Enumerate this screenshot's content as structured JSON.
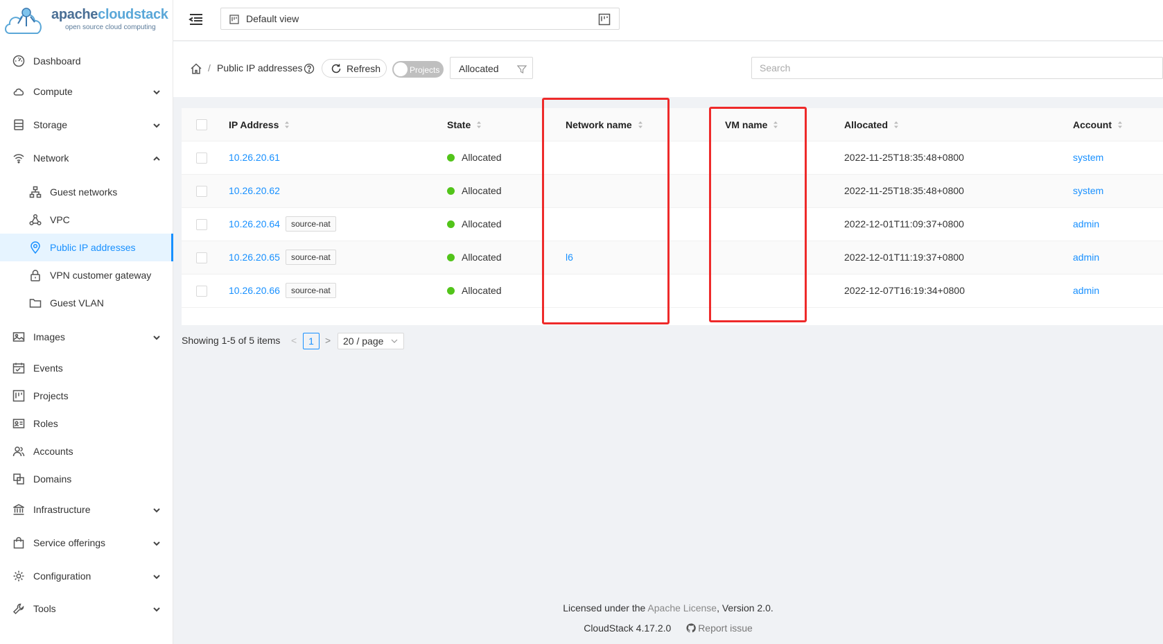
{
  "brand": {
    "name_part1": "apache",
    "name_part2": "cloudstack",
    "tagline": "open source cloud computing"
  },
  "sidebar": {
    "items": [
      {
        "label": "Dashboard",
        "icon": "dashboard-icon"
      },
      {
        "label": "Compute",
        "icon": "cloud-icon",
        "expandable": true
      },
      {
        "label": "Storage",
        "icon": "database-icon",
        "expandable": true
      },
      {
        "label": "Network",
        "icon": "wifi-icon",
        "expanded": true
      },
      {
        "label": "Guest networks",
        "icon": "network-tree-icon",
        "sub": true
      },
      {
        "label": "VPC",
        "icon": "deployment-icon",
        "sub": true
      },
      {
        "label": "Public IP addresses",
        "icon": "environment-icon",
        "sub": true,
        "active": true
      },
      {
        "label": "VPN customer gateway",
        "icon": "lock-icon",
        "sub": true
      },
      {
        "label": "Guest VLAN",
        "icon": "folder-icon",
        "sub": true
      },
      {
        "label": "Images",
        "icon": "picture-icon",
        "expandable": true
      },
      {
        "label": "Events",
        "icon": "schedule-icon"
      },
      {
        "label": "Projects",
        "icon": "project-icon"
      },
      {
        "label": "Roles",
        "icon": "idcard-icon"
      },
      {
        "label": "Accounts",
        "icon": "team-icon"
      },
      {
        "label": "Domains",
        "icon": "block-icon"
      },
      {
        "label": "Infrastructure",
        "icon": "bank-icon",
        "expandable": true
      },
      {
        "label": "Service offerings",
        "icon": "shopping-icon",
        "expandable": true
      },
      {
        "label": "Configuration",
        "icon": "setting-icon",
        "expandable": true
      },
      {
        "label": "Tools",
        "icon": "tool-icon",
        "expandable": true
      }
    ]
  },
  "header": {
    "view_label": "Default view"
  },
  "toolbar": {
    "breadcrumb_sep": "/",
    "title": "Public IP addresses",
    "refresh_label": "Refresh",
    "projects_toggle_label": "Projects",
    "filter_value": "Allocated",
    "search_placeholder": "Search"
  },
  "table": {
    "columns": [
      "IP Address",
      "State",
      "Network name",
      "VM name",
      "Allocated",
      "Account"
    ],
    "rows": [
      {
        "ip": "10.26.20.61",
        "tag": "",
        "state": "Allocated",
        "network": "",
        "vm": "",
        "allocated": "2022-11-25T18:35:48+0800",
        "account": "system"
      },
      {
        "ip": "10.26.20.62",
        "tag": "",
        "state": "Allocated",
        "network": "",
        "vm": "",
        "allocated": "2022-11-25T18:35:48+0800",
        "account": "system"
      },
      {
        "ip": "10.26.20.64",
        "tag": "source-nat",
        "state": "Allocated",
        "network": "",
        "vm": "",
        "allocated": "2022-12-01T11:09:37+0800",
        "account": "admin"
      },
      {
        "ip": "10.26.20.65",
        "tag": "source-nat",
        "state": "Allocated",
        "network": "l6",
        "vm": "",
        "allocated": "2022-12-01T11:19:37+0800",
        "account": "admin"
      },
      {
        "ip": "10.26.20.66",
        "tag": "source-nat",
        "state": "Allocated",
        "network": "",
        "vm": "",
        "allocated": "2022-12-07T16:19:34+0800",
        "account": "admin"
      }
    ]
  },
  "pagination": {
    "total": "Showing 1-5 of 5 items",
    "prev": "<",
    "page": "1",
    "next": ">",
    "page_size": "20 / page"
  },
  "footer": {
    "license_prefix": "Licensed under the",
    "license_link": "Apache License",
    "license_suffix": ", Version 2.0.",
    "version": "CloudStack 4.17.2.0",
    "report_issue": "Report issue"
  },
  "colors": {
    "accent": "#1890ff",
    "status_allocated": "#52c41a",
    "highlight": "#ee2a2a"
  }
}
